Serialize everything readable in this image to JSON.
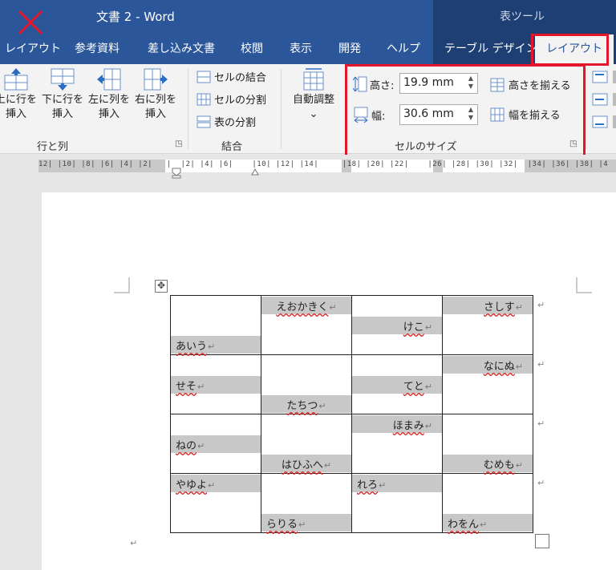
{
  "titlebar": {
    "title": "文書 2  -  Word",
    "context_title": "表ツール"
  },
  "tabs": [
    {
      "id": "layout-left",
      "label": "レイアウト"
    },
    {
      "id": "references",
      "label": "参考資料"
    },
    {
      "id": "mailings",
      "label": "差し込み文書"
    },
    {
      "id": "review",
      "label": "校閲"
    },
    {
      "id": "view",
      "label": "表示"
    },
    {
      "id": "developer",
      "label": "開発"
    },
    {
      "id": "help",
      "label": "ヘルプ"
    },
    {
      "id": "table-design",
      "label": "テーブル デザイン"
    },
    {
      "id": "table-layout",
      "label": "レイアウト"
    }
  ],
  "ribbon": {
    "rows_cols": {
      "insert_above": {
        "line1": "上に行を",
        "line2": "挿入"
      },
      "insert_below": {
        "line1": "下に行を",
        "line2": "挿入"
      },
      "insert_left": {
        "line1": "左に列を",
        "line2": "挿入"
      },
      "insert_right": {
        "line1": "右に列を",
        "line2": "挿入"
      },
      "label": "行と列"
    },
    "merge": {
      "merge_cells": "セルの結合",
      "split_cells": "セルの分割",
      "split_table": "表の分割",
      "label": "結合"
    },
    "autofit": {
      "label": "自動調整",
      "chevron": "⌄"
    },
    "cell_size": {
      "height_label": "高さ:",
      "height_value": "19.9 mm",
      "width_label": "幅:",
      "width_value": "30.6 mm",
      "distribute_rows": "高さを揃える",
      "distribute_cols": "幅を揃える",
      "label": "セルのサイズ"
    }
  },
  "ruler": {
    "text": "12| |10| |8| |6| |4| |2|   |  |2| |4| |6|    |10| |12| |14|     |18| |20| |22|    |26| |28| |30| |32|  |34| |36| |38| |4"
  },
  "table": {
    "rows": [
      [
        {
          "text": "あいう",
          "pos": "bot",
          "align": "left"
        },
        {
          "text": "えおかきく",
          "pos": "top",
          "align": "center"
        },
        {
          "text": "けこ",
          "pos": "mid",
          "align": "right"
        },
        {
          "text": "さしす",
          "pos": "top",
          "align": "right"
        }
      ],
      [
        {
          "text": "せそ",
          "pos": "mid",
          "align": "left"
        },
        {
          "text": "たちつ",
          "pos": "bot",
          "align": "center"
        },
        {
          "text": "てと",
          "pos": "mid",
          "align": "right"
        },
        {
          "text": "なにぬ",
          "pos": "top",
          "align": "right"
        }
      ],
      [
        {
          "text": "ねの",
          "pos": "mid",
          "align": "left"
        },
        {
          "text": "はひふへ",
          "pos": "bot",
          "align": "center"
        },
        {
          "text": "ほまみ",
          "pos": "top",
          "align": "right"
        },
        {
          "text": "むめも",
          "pos": "bot",
          "align": "right"
        }
      ],
      [
        {
          "text": "やゆよ",
          "pos": "top",
          "align": "left"
        },
        {
          "text": "らりる",
          "pos": "bot",
          "align": "left"
        },
        {
          "text": "れろ",
          "pos": "top",
          "align": "left"
        },
        {
          "text": "わをん",
          "pos": "bot",
          "align": "left"
        }
      ]
    ],
    "para_mark": "↵",
    "move_handle": "✥"
  },
  "colors": {
    "brand": "#2b579a",
    "highlight": "#e3162b",
    "cell_shade": "#c8c8c8"
  }
}
